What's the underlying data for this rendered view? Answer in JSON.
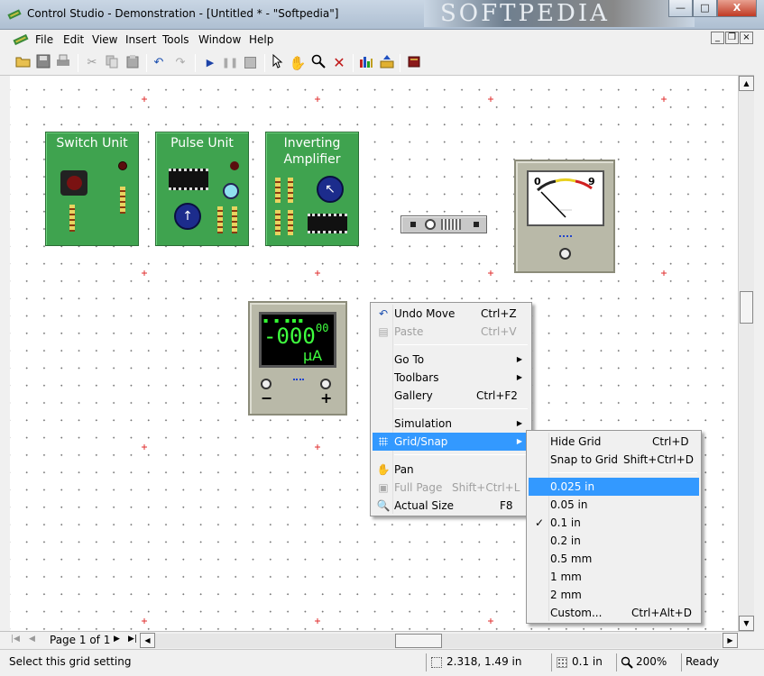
{
  "window": {
    "title": "Control Studio - Demonstration - [Untitled * - \"Softpedia\"]",
    "watermark": "SOFTPEDIA",
    "minimize": "—",
    "maximize": "□",
    "close": "X"
  },
  "menubar": {
    "items": [
      "File",
      "Edit",
      "View",
      "Insert",
      "Tools",
      "Window",
      "Help"
    ],
    "mdi_minimize": "_",
    "mdi_restore": "❐",
    "mdi_close": "×"
  },
  "toolbar": {
    "icons": [
      "open-icon",
      "save-icon",
      "print-icon",
      "cut-icon",
      "copy-icon",
      "paste-icon",
      "undo-icon",
      "redo-icon",
      "play-icon",
      "pause-icon",
      "stop-icon",
      "pointer-icon",
      "hand-icon",
      "zoom-icon",
      "delete-icon",
      "chart-icon",
      "export-icon",
      "book-icon"
    ]
  },
  "modules": [
    {
      "title": "Switch Unit"
    },
    {
      "title": "Pulse Unit"
    },
    {
      "title_line1": "Inverting",
      "title_line2": "Amplifier"
    }
  ],
  "meter": {
    "scale_min": "0",
    "scale_max": "9",
    "needle_value": 0.5
  },
  "display": {
    "value": "-000",
    "superscript": "00",
    "unit": "µA",
    "minus": "−",
    "plus": "+"
  },
  "context_menu": {
    "items": [
      {
        "label": "Undo Move",
        "shortcut": "Ctrl+Z",
        "icon": "undo-icon",
        "enabled": true
      },
      {
        "label": "Paste",
        "shortcut": "Ctrl+V",
        "icon": "paste-icon",
        "enabled": false
      },
      {
        "label": "Go To",
        "submenu": true,
        "enabled": true
      },
      {
        "label": "Toolbars",
        "submenu": true,
        "enabled": true
      },
      {
        "label": "Gallery",
        "shortcut": "Ctrl+F2",
        "enabled": true
      },
      {
        "label": "Simulation",
        "submenu": true,
        "enabled": true
      },
      {
        "label": "Grid/Snap",
        "submenu": true,
        "icon": "grid-icon",
        "enabled": true,
        "highlighted": true
      },
      {
        "label": "Pan",
        "icon": "hand-icon",
        "enabled": true
      },
      {
        "label": "Full Page",
        "shortcut": "Shift+Ctrl+L",
        "icon": "full-page-icon",
        "enabled": false
      },
      {
        "label": "Actual Size",
        "shortcut": "F8",
        "icon": "actual-size-icon",
        "enabled": true
      }
    ],
    "arrow": "▶"
  },
  "grid_submenu": {
    "items": [
      {
        "label": "Hide Grid",
        "shortcut": "Ctrl+D"
      },
      {
        "label": "Snap to Grid",
        "shortcut": "Shift+Ctrl+D"
      },
      {
        "label": "0.025 in",
        "highlighted": true
      },
      {
        "label": "0.05 in"
      },
      {
        "label": "0.1 in",
        "checked": true
      },
      {
        "label": "0.2 in"
      },
      {
        "label": "0.5 mm"
      },
      {
        "label": "1 mm"
      },
      {
        "label": "2 mm"
      },
      {
        "label": "Custom...",
        "shortcut": "Ctrl+Alt+D"
      }
    ],
    "check": "✓"
  },
  "pager": {
    "label": "Page 1 of 1",
    "first": "|◀",
    "prev": "◀",
    "next": "▶",
    "last": "▶|",
    "scroll_left": "◀",
    "scroll_right": "▶"
  },
  "scrollbar": {
    "up": "▲",
    "down": "▼"
  },
  "status": {
    "message": "Select this grid setting",
    "coords": "2.318, 1.49 in",
    "grid": "0.1 in",
    "zoom": "200%",
    "state": "Ready"
  }
}
